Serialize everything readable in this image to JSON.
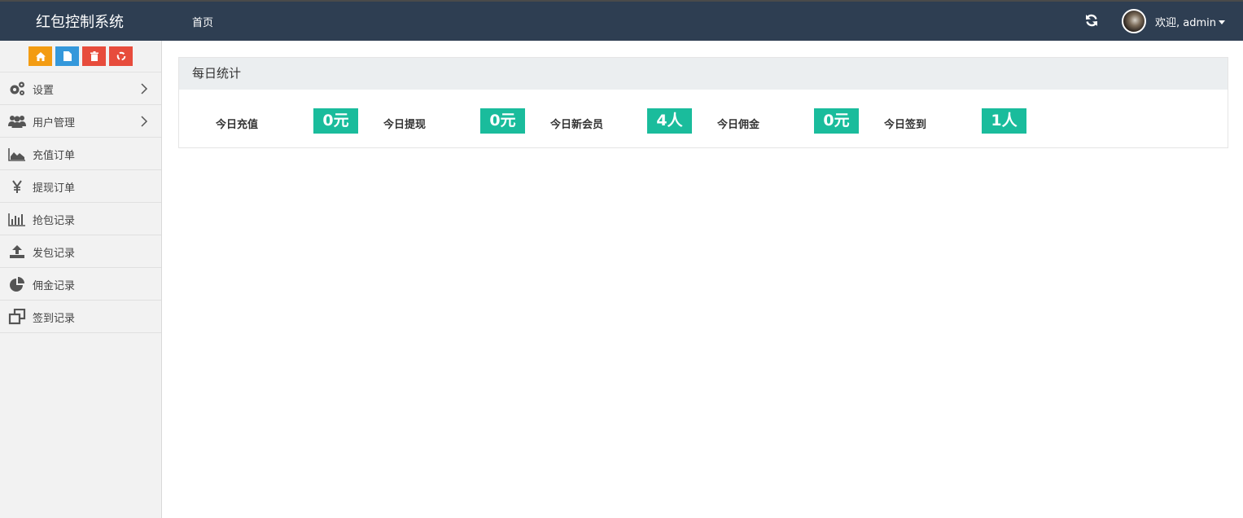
{
  "header": {
    "brand": "红包控制系统",
    "nav_home": "首页",
    "user_greeting": "欢迎, admin",
    "icons": [
      "refresh-icon",
      "avatar",
      "caret-down-icon"
    ]
  },
  "sidebar": {
    "shortcuts": [
      {
        "icon": "home-icon",
        "color": "#f39c12"
      },
      {
        "icon": "file-icon",
        "color": "#3498db"
      },
      {
        "icon": "trash-icon",
        "color": "#e74c3c"
      },
      {
        "icon": "recycle-icon",
        "color": "#e74c3c"
      }
    ],
    "items": [
      {
        "label": "设置",
        "icon": "gears-icon",
        "has_arrow": true
      },
      {
        "label": "用户管理",
        "icon": "users-icon",
        "has_arrow": true
      },
      {
        "label": "充值订单",
        "icon": "area-chart-icon",
        "has_arrow": false
      },
      {
        "label": "提现订单",
        "icon": "yen-icon",
        "has_arrow": false
      },
      {
        "label": "抢包记录",
        "icon": "bar-chart-icon",
        "has_arrow": false
      },
      {
        "label": "发包记录",
        "icon": "upload-icon",
        "has_arrow": false
      },
      {
        "label": "佣金记录",
        "icon": "pie-chart-icon",
        "has_arrow": false
      },
      {
        "label": "签到记录",
        "icon": "clone-icon",
        "has_arrow": false
      }
    ]
  },
  "main": {
    "panel_title": "每日统计",
    "stats": [
      {
        "label": "今日充值",
        "value": "0元"
      },
      {
        "label": "今日提现",
        "value": "0元"
      },
      {
        "label": "今日新会员",
        "value": "4人"
      },
      {
        "label": "今日佣金",
        "value": "0元"
      },
      {
        "label": "今日签到",
        "value": "1人"
      }
    ],
    "accent_color": "#1abc9c"
  },
  "colors": {
    "topbar": "#2e3e52",
    "sidebar": "#f2f2f2"
  }
}
